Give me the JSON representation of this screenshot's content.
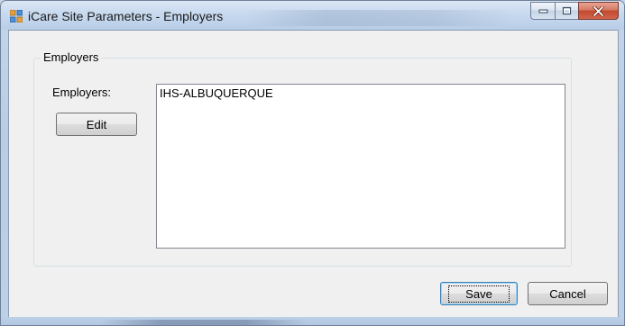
{
  "window": {
    "title": "iCare Site Parameters - Employers",
    "icon": "app-grid-icon",
    "caption_buttons": [
      "minimize-icon",
      "maximize-icon",
      "close-icon"
    ]
  },
  "group": {
    "title": "Employers",
    "field_label": "Employers:",
    "edit_label": "Edit",
    "items": [
      "IHS-ALBUQUERQUE"
    ]
  },
  "footer": {
    "save_label": "Save",
    "cancel_label": "Cancel"
  },
  "colors": {
    "frame": "#b9cde5",
    "client_bg": "#f0f0f0",
    "close_button": "#c14a2f",
    "focus_border": "#3c7fb1"
  }
}
